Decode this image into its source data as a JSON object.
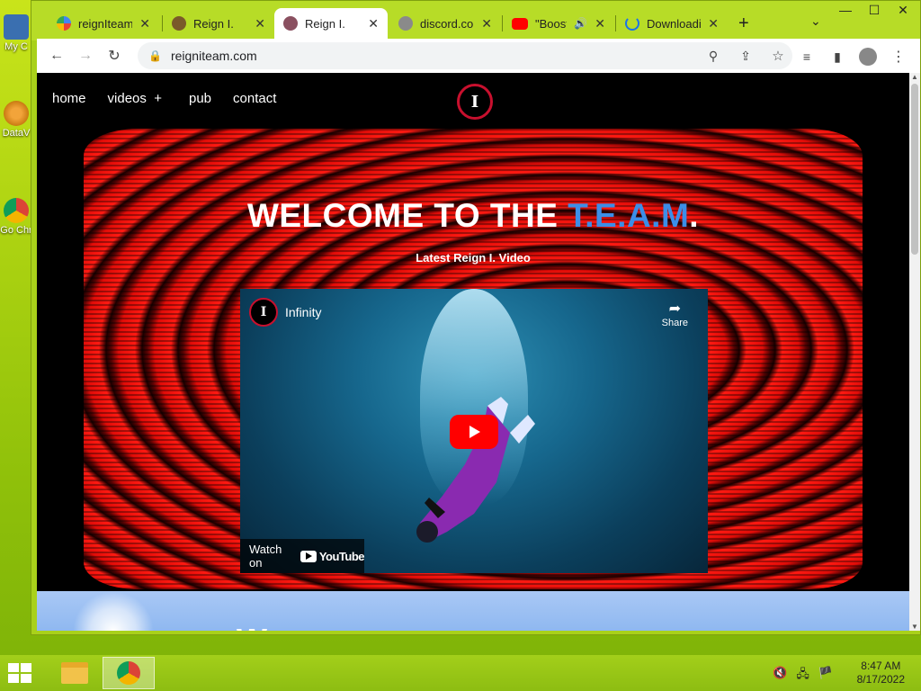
{
  "desktop": {
    "icons": [
      {
        "label": "My C"
      },
      {
        "label": "DataV"
      },
      {
        "label": "Go Chr"
      }
    ]
  },
  "browser": {
    "tabs": [
      {
        "label": "reignIteam.c",
        "favicon": "google-icon"
      },
      {
        "label": "Reign I.",
        "favicon": "reign-icon"
      },
      {
        "label": "Reign I.",
        "favicon": "reign-icon",
        "active": true
      },
      {
        "label": "discord.com",
        "favicon": "globe-icon"
      },
      {
        "label": "\"Boost",
        "favicon": "youtube-icon",
        "audio": true
      },
      {
        "label": "Downloadin",
        "favicon": "loading-icon"
      }
    ],
    "url": "reigniteam.com"
  },
  "site": {
    "nav": [
      "home",
      "videos",
      "+",
      "pub",
      "contact"
    ],
    "logo_letter": "I",
    "hero": {
      "title_prefix": "WELCOME TO THE ",
      "title_team": "T.E.A.M",
      "title_suffix": ".",
      "subtitle": "Latest Reign I. Video"
    },
    "video": {
      "channel_letter": "I",
      "title": "Infinity",
      "share_label": "Share",
      "watch_on": "Watch on",
      "youtube": "YouTube"
    },
    "next_section_title": "W"
  },
  "taskbar": {
    "time": "8:47 AM",
    "date": "8/17/2022"
  }
}
